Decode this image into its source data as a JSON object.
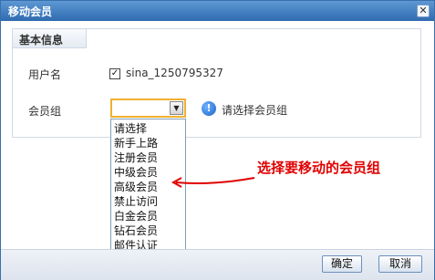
{
  "dialog": {
    "title": "移动会员",
    "close_icon": "close-icon"
  },
  "section": {
    "legend": "基本信息"
  },
  "form": {
    "username_label": "用户名",
    "username_checked": true,
    "username_value": "sina_1250795327",
    "group_label": "会员组",
    "group_selected": "",
    "hint_text": "请选择会员组",
    "hint_icon": "info-icon",
    "group_options": [
      "请选择",
      "新手上路",
      "注册会员",
      "中级会员",
      "高级会员",
      "禁止访问",
      "白金会员",
      "钻石会员",
      "邮件认证"
    ]
  },
  "annotation": {
    "text": "选择要移动的会员组",
    "color": "#e00000"
  },
  "buttons": {
    "ok_label": "确定",
    "cancel_label": "取消"
  }
}
